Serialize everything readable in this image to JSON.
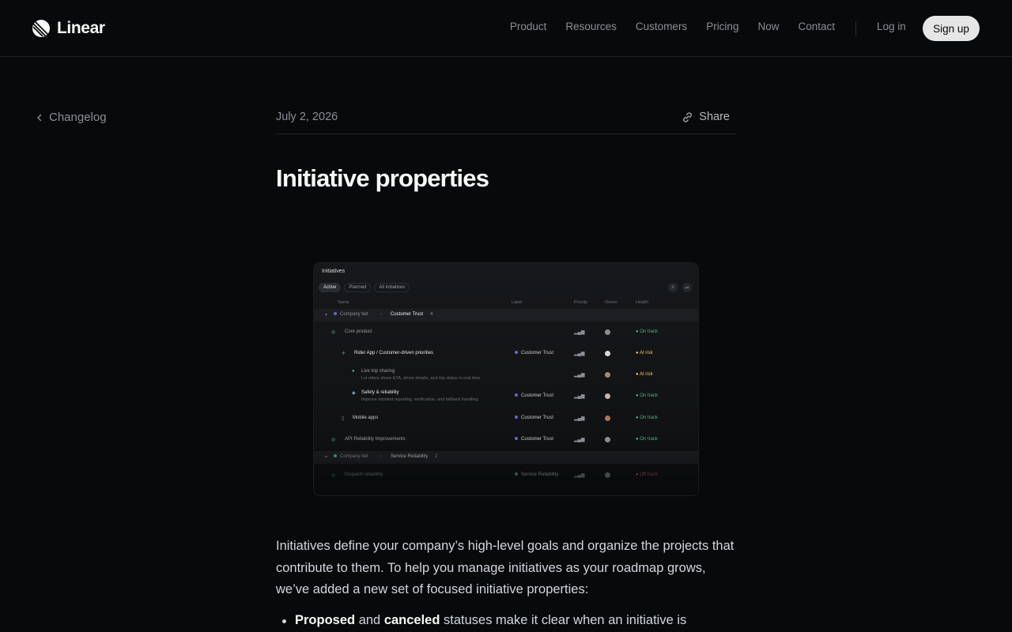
{
  "brand": {
    "name": "Linear"
  },
  "nav": {
    "links": [
      "Product",
      "Resources",
      "Customers",
      "Pricing",
      "Now",
      "Contact"
    ],
    "login": "Log in",
    "signup": "Sign up"
  },
  "back": {
    "label": "Changelog"
  },
  "post": {
    "date": "July 2, 2026",
    "share": "Share",
    "title": "Initiative properties",
    "intro": "Initiatives define your company’s high-level goals and organize the projects that contribute to them. To help you manage initiatives as your roadmap grows, we’ve added a new set of focused initiative properties:",
    "bullet1": {
      "bold1": "Proposed",
      "mid": " and ",
      "bold2": "canceled",
      "rest": " statuses make it clear when an initiative is"
    }
  },
  "screenshot": {
    "title": "Initiatives",
    "tabs": [
      "Active",
      "Planned",
      "All initiatives"
    ],
    "columns": [
      "Name",
      "Label",
      "Priority",
      "Owner",
      "Health"
    ],
    "groups": [
      {
        "label": "Company bet",
        "name": "Customer Trust",
        "count": "4"
      },
      {
        "label": "Company bet",
        "name": "Service Reliability",
        "count": "2"
      }
    ],
    "rows": [
      {
        "name": "Core product",
        "label": "",
        "health": "On track"
      },
      {
        "name": "Rider App / Customer-driven priorities",
        "label": "Customer Trust",
        "health": "At risk"
      },
      {
        "name": "Live trip sharing",
        "desc": "Let riders share ETA, driver details, and trip status in real time",
        "label": "",
        "health": "At risk"
      },
      {
        "name": "Safety & reliability",
        "desc": "Improve incident reporting, verification, and fallback handling",
        "label": "Customer Trust",
        "health": "On track"
      },
      {
        "name": "Mobile apps",
        "label": "Customer Trust",
        "health": "On track"
      },
      {
        "name": "API Reliability Improvements",
        "label": "Customer Trust",
        "health": "On track"
      },
      {
        "name": "Dispatch reliability",
        "label": "Service Reliability",
        "health": "Off track"
      }
    ]
  },
  "colors": {
    "background": "#08090a",
    "accent": "#5e6ad2",
    "on_track": "#4cb782",
    "at_risk": "#f2c94c"
  }
}
